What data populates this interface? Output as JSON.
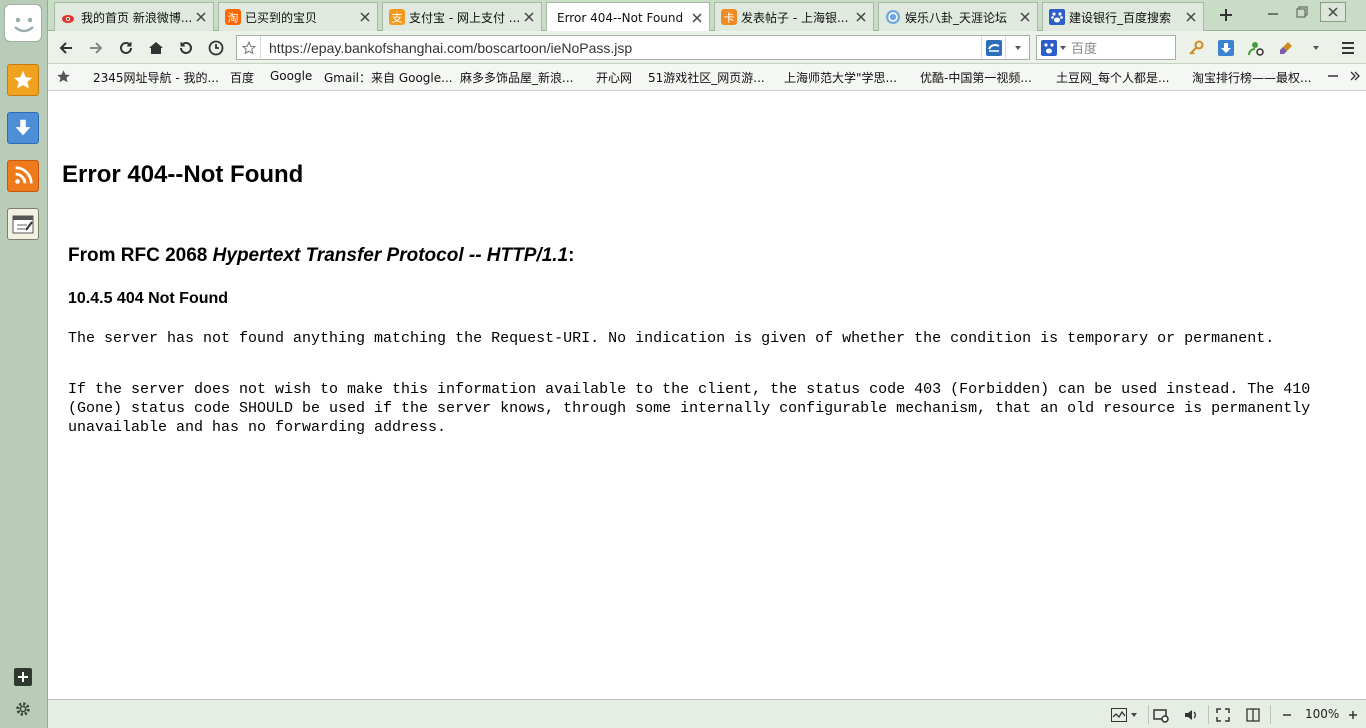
{
  "tabs": [
    {
      "label": "我的首页 新浪微博...",
      "favicon": "weibo-icon",
      "active": false
    },
    {
      "label": "已买到的宝贝",
      "favicon": "taobao-icon",
      "active": false
    },
    {
      "label": "支付宝 - 网上支付 ...",
      "favicon": "alipay-icon",
      "active": false
    },
    {
      "label": "Error 404--Not Found",
      "favicon": "",
      "active": true
    },
    {
      "label": "发表帖子 - 上海银...",
      "favicon": "forum-icon",
      "active": false
    },
    {
      "label": "娱乐八卦_天涯论坛",
      "favicon": "tianya-icon",
      "active": false
    },
    {
      "label": "建设银行_百度搜索",
      "favicon": "baidu-paw-icon",
      "active": false
    }
  ],
  "address": {
    "url": "https://epay.bankofshanghai.com/boscartoon/ieNoPass.jsp"
  },
  "search": {
    "placeholder": "百度"
  },
  "bookmarks": [
    "2345网址导航 - 我的...",
    "百度",
    "Google",
    "Gmail：来自 Google...",
    "麻多多饰品屋_新浪...",
    "开心网",
    "51游戏社区_网页游...",
    "上海师范大学\"学思...",
    "优酷-中国第一视频...",
    "土豆网_每个人都是...",
    "淘宝排行榜——最权..."
  ],
  "page": {
    "title": "Error 404--Not Found",
    "section_prefix": "From RFC 2068 ",
    "section_italic": "Hypertext Transfer Protocol -- HTTP/1.1",
    "section_suffix": ":",
    "subsection": "10.4.5 404 Not Found",
    "para1": "The server has not found anything matching the Request-URI. No indication is given of whether the condition is temporary or permanent.",
    "para2": "If the server does not wish to make this information available to the client, the status code 403 (Forbidden) can be used instead. The 410 (Gone) status code SHOULD be used if the server knows, through some internally configurable mechanism, that an old resource is permanently unavailable and has no forwarding address."
  },
  "status": {
    "zoom": "100%"
  },
  "colors": {
    "chrome_green": "#c9dcc6",
    "sidebar_green": "#b9ccb8",
    "accent_blue": "#2c6fb8"
  }
}
